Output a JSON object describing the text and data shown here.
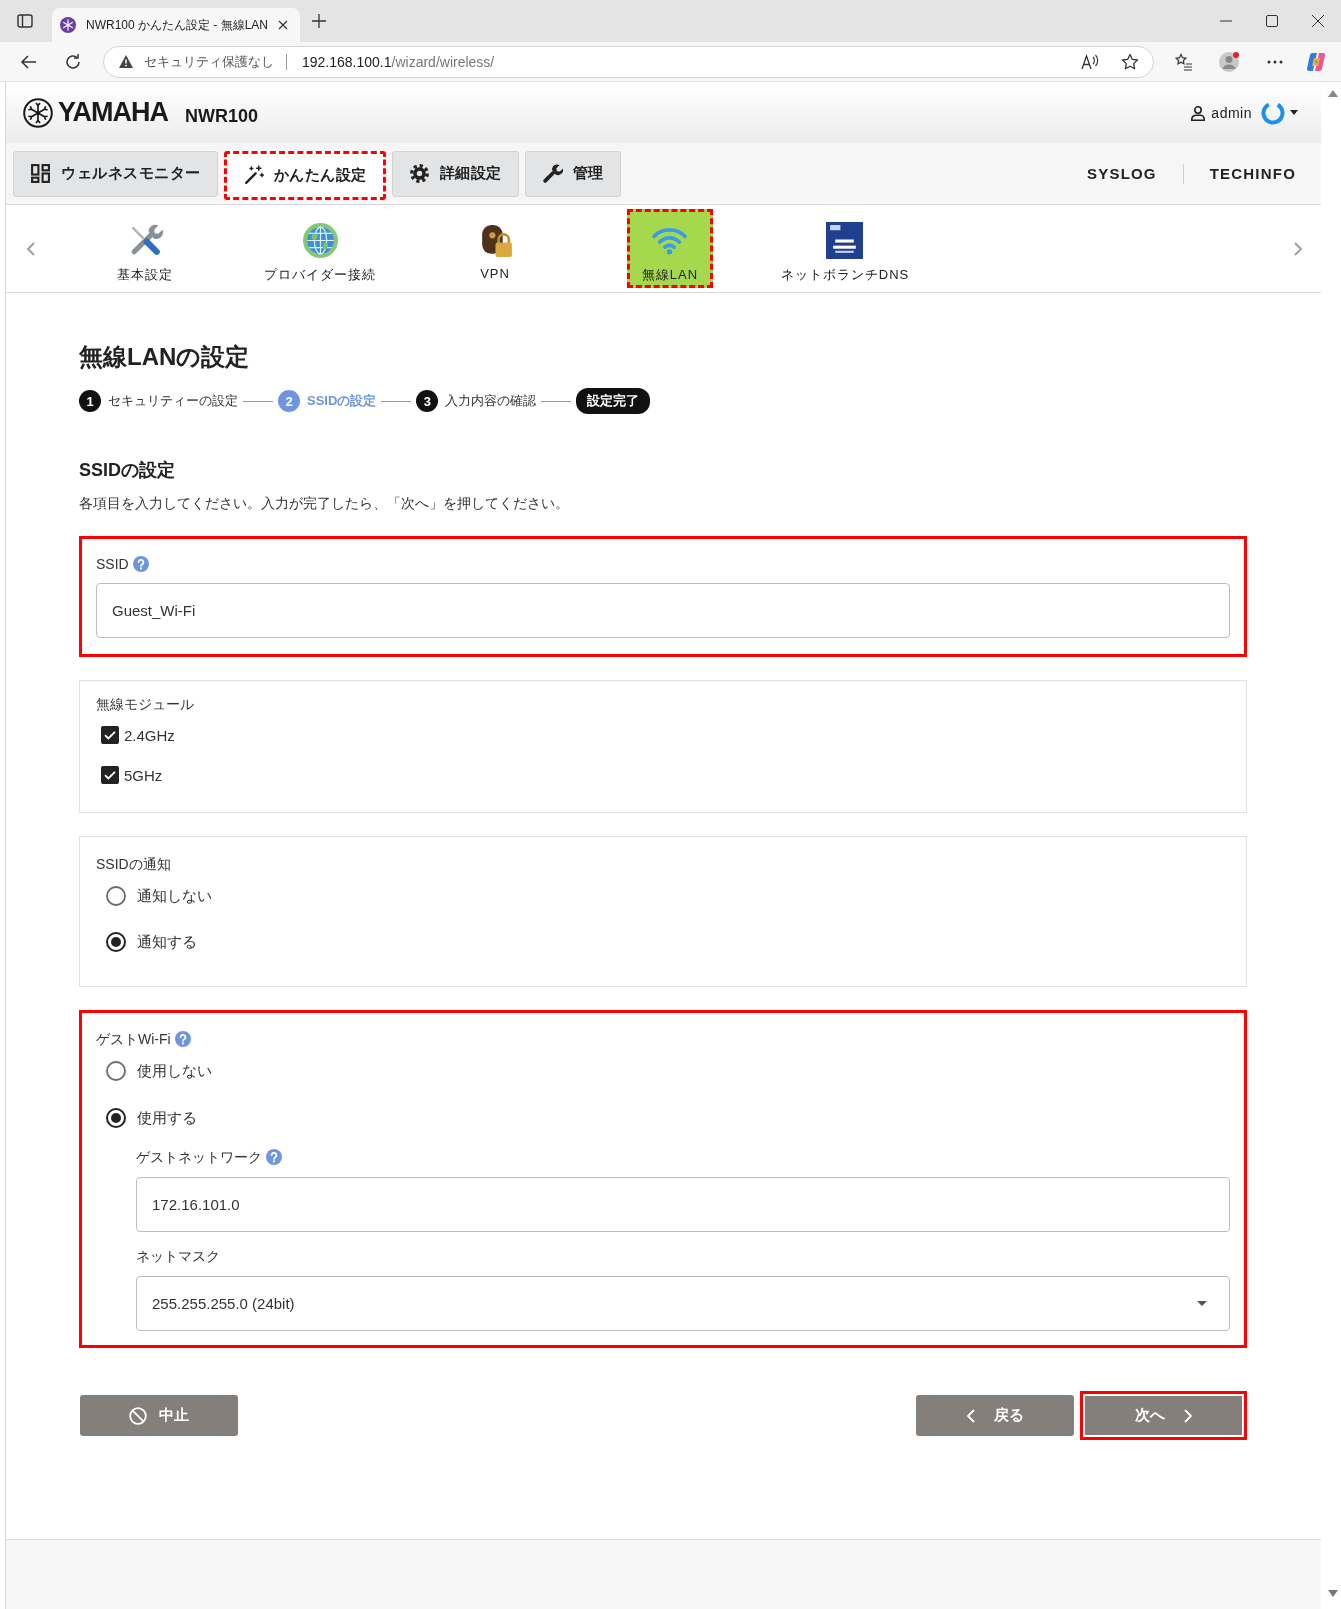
{
  "browser": {
    "tab_title": "NWR100 かんたん設定 - 無線LAN",
    "security_label": "セキュリティ保護なし",
    "url_host": "192.168.100.1",
    "url_path": "/wizard/wireless/"
  },
  "header": {
    "brand": "YAMAHA",
    "model": "NWR100",
    "user": "admin"
  },
  "main_nav": {
    "tabs": [
      {
        "label": "ウェルネスモニター",
        "selected": false,
        "highlighted": false
      },
      {
        "label": "かんたん設定",
        "selected": true,
        "highlighted": true
      },
      {
        "label": "詳細設定",
        "selected": false,
        "highlighted": false
      },
      {
        "label": "管理",
        "selected": false,
        "highlighted": false
      }
    ],
    "links": [
      "SYSLOG",
      "TECHINFO"
    ]
  },
  "sub_nav": {
    "items": [
      {
        "label": "基本設定",
        "selected": false,
        "highlighted": false
      },
      {
        "label": "プロバイダー接続",
        "selected": false,
        "highlighted": false
      },
      {
        "label": "VPN",
        "selected": false,
        "highlighted": false
      },
      {
        "label": "無線LAN",
        "selected": true,
        "highlighted": true
      },
      {
        "label": "ネットボランチDNS",
        "selected": false,
        "highlighted": false
      }
    ]
  },
  "wizard": {
    "title": "無線LANの設定",
    "steps": [
      {
        "kind": "numbered",
        "number": "1",
        "label": "セキュリティーの設定",
        "selected": false
      },
      {
        "kind": "numbered",
        "number": "2",
        "label": "SSIDの設定",
        "selected": true
      },
      {
        "kind": "numbered",
        "number": "3",
        "label": "入力内容の確認",
        "selected": false
      },
      {
        "kind": "final",
        "label": "設定完了",
        "selected": false
      }
    ]
  },
  "form": {
    "title": "SSIDの設定",
    "description": "各項目を入力してください。入力が完了したら、「次へ」を押してください。",
    "sections": [
      {
        "kind": "text",
        "label": "SSID",
        "help": true,
        "value": "Guest_Wi-Fi",
        "highlighted": true
      },
      {
        "kind": "checkboxes",
        "label": "無線モジュール",
        "highlighted": false,
        "options": [
          {
            "label": "2.4GHz",
            "checked": true
          },
          {
            "label": "5GHz",
            "checked": true
          }
        ]
      },
      {
        "kind": "radios",
        "label": "SSIDの通知",
        "highlighted": false,
        "options": [
          {
            "label": "通知しない",
            "selected": false
          },
          {
            "label": "通知する",
            "selected": true
          }
        ]
      },
      {
        "kind": "radios",
        "label": "ゲストWi-Fi",
        "help": true,
        "highlighted": true,
        "options": [
          {
            "label": "使用しない",
            "selected": false
          },
          {
            "label": "使用する",
            "selected": true
          }
        ],
        "subfields": [
          {
            "kind": "text",
            "label": "ゲストネットワーク",
            "help": true,
            "value": "172.16.101.0"
          },
          {
            "kind": "select",
            "label": "ネットマスク",
            "value": "255.255.255.0 (24bit)"
          }
        ]
      }
    ]
  },
  "buttons": [
    {
      "kind": "cancel",
      "label": "中止",
      "highlighted": false
    },
    {
      "kind": "back",
      "label": "戻る",
      "highlighted": false
    },
    {
      "kind": "next",
      "label": "次へ",
      "highlighted": true
    }
  ]
}
